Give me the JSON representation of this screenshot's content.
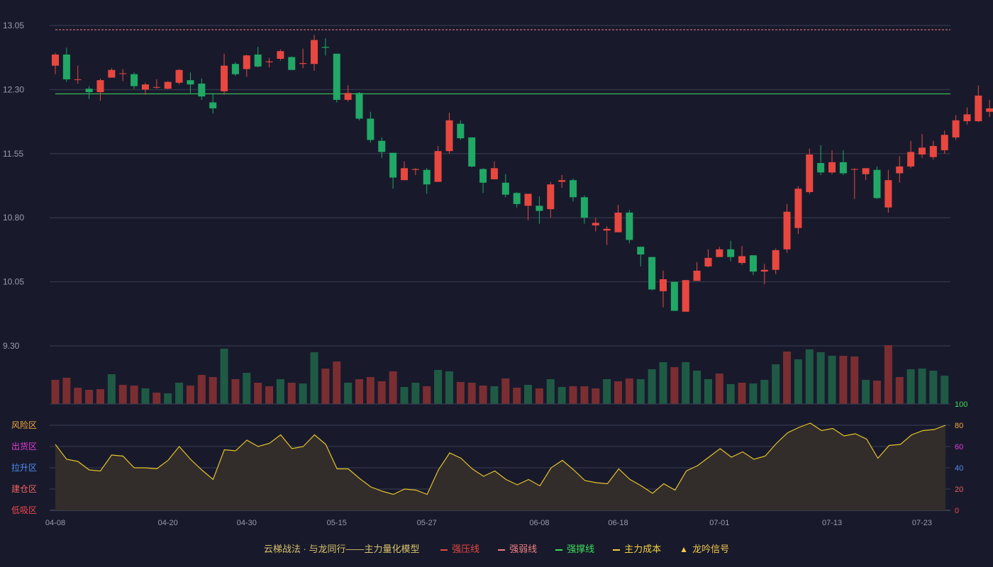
{
  "colors": {
    "background": "#181a2c",
    "up": "#e8473f",
    "down": "#21a866",
    "vol_up": "#7a2e31",
    "vol_down": "#1f5a45",
    "grid": "#3a3d52",
    "tick": "#9a9cab",
    "resistance": "#e8473f",
    "weak": "#f07f80",
    "support": "#3ddc5a",
    "cost": "#f2d13e",
    "osc_line": "#e5c22b",
    "osc_fill": "#322d2a",
    "zone_risk": "#f1a73a",
    "zone_ship": "#e13cd6",
    "zone_rise": "#4f8ef0",
    "zone_build": "#ef6060",
    "zone_low": "#f0464a"
  },
  "footer": {
    "title": "云梯战法 · 与龙同行——主力量化模型",
    "items": [
      {
        "label": "强压线",
        "color": "#e8473f",
        "style": "solid"
      },
      {
        "label": "强弱线",
        "color": "#f07f80",
        "style": "dash"
      },
      {
        "label": "强撑线",
        "color": "#3ddc5a",
        "style": "solid"
      },
      {
        "label": "主力成本",
        "color": "#f2d13e",
        "style": "dash"
      },
      {
        "label": "龙吟信号",
        "color": "#f2c84b",
        "style": "triangle",
        "symbol": "▲"
      }
    ]
  },
  "chart_data": [
    {
      "type": "candlestick",
      "title": "",
      "x": [
        "04-08",
        "04-09",
        "04-10",
        "04-11",
        "04-12",
        "04-15",
        "04-16",
        "04-17",
        "04-18",
        "04-19",
        "04-20",
        "04-22",
        "04-23",
        "04-24",
        "04-25",
        "04-26",
        "04-29",
        "04-30",
        "05-06",
        "05-07",
        "05-08",
        "05-09",
        "05-10",
        "05-13",
        "05-14",
        "05-15",
        "05-16",
        "05-17",
        "05-20",
        "05-21",
        "05-22",
        "05-23",
        "05-24",
        "05-27",
        "05-28",
        "05-29",
        "05-30",
        "05-31",
        "06-03",
        "06-04",
        "06-05",
        "06-06",
        "06-07",
        "06-08",
        "06-11",
        "06-12",
        "06-13",
        "06-14",
        "06-15",
        "06-17",
        "06-18",
        "06-19",
        "06-20",
        "06-21",
        "06-24",
        "06-25",
        "06-26",
        "06-27",
        "06-28",
        "07-01",
        "07-02",
        "07-03",
        "07-04",
        "07-05",
        "07-08",
        "07-09",
        "07-10",
        "07-11",
        "07-12",
        "07-13",
        "07-15",
        "07-16",
        "07-17",
        "07-18",
        "07-19",
        "07-20",
        "07-22",
        "07-23",
        "07-24",
        "07-25",
        "07-26",
        "07-29",
        "07-30",
        "07-31",
        "08-01",
        "08-02",
        "08-05"
      ],
      "x_ticks": [
        "04-08",
        "04-20",
        "04-30",
        "05-15",
        "05-27",
        "06-08",
        "06-18",
        "07-01",
        "07-13",
        "07-23"
      ],
      "y_ticks": [
        "9.30",
        "10.05",
        "10.80",
        "11.55",
        "12.30",
        "13.05"
      ],
      "ylim": [
        9.3,
        13.05
      ],
      "ohlc": [
        [
          12.58,
          12.71,
          12.48,
          12.73
        ],
        [
          12.71,
          12.42,
          12.39,
          12.79
        ],
        [
          12.42,
          12.42,
          12.37,
          12.58
        ],
        [
          12.31,
          12.27,
          12.19,
          12.34
        ],
        [
          12.27,
          12.41,
          12.17,
          12.43
        ],
        [
          12.44,
          12.53,
          12.44,
          12.55
        ],
        [
          12.49,
          12.49,
          12.4,
          12.54
        ],
        [
          12.48,
          12.34,
          12.31,
          12.5
        ],
        [
          12.3,
          12.36,
          12.24,
          12.38
        ],
        [
          12.33,
          12.33,
          12.31,
          12.42
        ],
        [
          12.31,
          12.39,
          12.3,
          12.4
        ],
        [
          12.38,
          12.53,
          12.36,
          12.54
        ],
        [
          12.41,
          12.36,
          12.25,
          12.5
        ],
        [
          12.37,
          12.22,
          12.18,
          12.43
        ],
        [
          12.15,
          12.08,
          12.02,
          12.26
        ],
        [
          12.28,
          12.58,
          12.24,
          12.72
        ],
        [
          12.6,
          12.48,
          12.46,
          12.62
        ],
        [
          12.54,
          12.7,
          12.45,
          12.71
        ],
        [
          12.71,
          12.57,
          12.56,
          12.8
        ],
        [
          12.62,
          12.63,
          12.56,
          12.67
        ],
        [
          12.66,
          12.75,
          12.64,
          12.77
        ],
        [
          12.68,
          12.53,
          12.53,
          12.69
        ],
        [
          12.6,
          12.61,
          12.55,
          12.78
        ],
        [
          12.6,
          12.88,
          12.52,
          12.94
        ],
        [
          12.8,
          12.79,
          12.7,
          12.9
        ],
        [
          12.72,
          12.18,
          12.15,
          12.72
        ],
        [
          12.18,
          12.26,
          12.16,
          12.35
        ],
        [
          12.26,
          11.96,
          11.94,
          12.27
        ],
        [
          11.96,
          11.71,
          11.68,
          12.04
        ],
        [
          11.7,
          11.57,
          11.5,
          11.74
        ],
        [
          11.56,
          11.27,
          11.14,
          11.56
        ],
        [
          11.24,
          11.38,
          11.24,
          11.46
        ],
        [
          11.36,
          11.37,
          11.3,
          11.38
        ],
        [
          11.36,
          11.19,
          11.08,
          11.38
        ],
        [
          11.22,
          11.58,
          11.22,
          11.64
        ],
        [
          11.58,
          11.94,
          11.55,
          12.03
        ],
        [
          11.9,
          11.73,
          11.71,
          11.94
        ],
        [
          11.74,
          11.4,
          11.39,
          11.74
        ],
        [
          11.37,
          11.21,
          11.09,
          11.38
        ],
        [
          11.25,
          11.38,
          11.25,
          11.46
        ],
        [
          11.21,
          11.07,
          11.04,
          11.31
        ],
        [
          11.09,
          10.96,
          10.92,
          11.1
        ],
        [
          10.94,
          11.08,
          10.77,
          11.08
        ],
        [
          10.94,
          10.88,
          10.73,
          11.05
        ],
        [
          10.9,
          11.19,
          10.8,
          11.22
        ],
        [
          11.22,
          11.24,
          11.15,
          11.3
        ],
        [
          11.24,
          11.04,
          10.99,
          11.26
        ],
        [
          11.04,
          10.8,
          10.73,
          11.06
        ],
        [
          10.71,
          10.74,
          10.64,
          10.8
        ],
        [
          10.65,
          10.67,
          10.48,
          10.7
        ],
        [
          10.63,
          10.86,
          10.63,
          10.95
        ],
        [
          10.86,
          10.54,
          10.5,
          10.89
        ],
        [
          10.46,
          10.37,
          10.23,
          10.46
        ],
        [
          10.34,
          9.96,
          9.95,
          10.34
        ],
        [
          9.94,
          10.08,
          9.75,
          10.18
        ],
        [
          10.05,
          9.71,
          9.82,
          10.05
        ],
        [
          9.7,
          10.07,
          9.8,
          10.07
        ],
        [
          10.06,
          10.18,
          10.08,
          10.28
        ],
        [
          10.23,
          10.33,
          10.22,
          10.43
        ],
        [
          10.34,
          10.43,
          10.34,
          10.46
        ],
        [
          10.43,
          10.34,
          10.29,
          10.53
        ],
        [
          10.27,
          10.35,
          10.25,
          10.47
        ],
        [
          10.36,
          10.17,
          10.13,
          10.36
        ],
        [
          10.17,
          10.19,
          10.02,
          10.26
        ],
        [
          10.19,
          10.42,
          10.14,
          10.44
        ],
        [
          10.43,
          10.87,
          10.39,
          10.96
        ],
        [
          10.68,
          11.14,
          10.61,
          11.17
        ],
        [
          11.1,
          11.54,
          11.08,
          11.61
        ],
        [
          11.44,
          11.33,
          11.3,
          11.65
        ],
        [
          11.33,
          11.45,
          11.31,
          11.59
        ],
        [
          11.45,
          11.32,
          11.3,
          11.59
        ],
        [
          11.37,
          11.37,
          11.02,
          11.38
        ],
        [
          11.31,
          11.38,
          11.24,
          11.38
        ],
        [
          11.36,
          11.03,
          11.02,
          11.4
        ],
        [
          10.92,
          11.24,
          10.86,
          11.36
        ],
        [
          11.32,
          11.4,
          11.21,
          11.52
        ],
        [
          11.4,
          11.57,
          11.38,
          11.7
        ],
        [
          11.54,
          11.62,
          11.5,
          11.78
        ],
        [
          11.51,
          11.64,
          11.48,
          11.7
        ],
        [
          11.59,
          11.77,
          11.55,
          11.82
        ],
        [
          11.74,
          11.94,
          11.71,
          12.0
        ],
        [
          11.93,
          12.01,
          11.89,
          12.09
        ],
        [
          11.93,
          12.23,
          11.92,
          12.35
        ],
        [
          12.04,
          12.08,
          11.98,
          12.18
        ],
        [
          12.13,
          12.05,
          12.01,
          12.18
        ],
        [
          12.14,
          12.16,
          12.04,
          12.19
        ],
        [
          12.16,
          12.29,
          12.11,
          12.34
        ]
      ],
      "reference_lines": [
        {
          "name": "强弱线",
          "value": 13.0,
          "style": "dash"
        },
        {
          "name": "强撑线",
          "value": 12.25,
          "style": "solid"
        }
      ]
    },
    {
      "type": "bar",
      "title": "",
      "values": [
        34,
        37,
        23,
        20,
        21,
        42,
        27,
        26,
        22,
        16,
        15,
        30,
        26,
        41,
        38,
        78,
        35,
        44,
        30,
        25,
        35,
        30,
        29,
        73,
        50,
        60,
        30,
        35,
        38,
        32,
        46,
        24,
        30,
        25,
        48,
        46,
        31,
        30,
        26,
        25,
        36,
        23,
        27,
        22,
        35,
        24,
        25,
        25,
        22,
        35,
        32,
        36,
        35,
        49,
        59,
        52,
        59,
        47,
        35,
        43,
        28,
        30,
        29,
        34,
        56,
        74,
        63,
        77,
        73,
        68,
        68,
        67,
        34,
        33,
        83,
        38,
        49,
        50,
        47,
        40
      ],
      "direction": [
        "up",
        "up",
        "up",
        "up",
        "up",
        "down",
        "up",
        "up",
        "down",
        "up",
        "down",
        "down",
        "up",
        "up",
        "up",
        "down",
        "up",
        "down",
        "up",
        "up",
        "down",
        "up",
        "down",
        "down",
        "up",
        "up",
        "down",
        "up",
        "up",
        "up",
        "up",
        "down",
        "down",
        "up",
        "down",
        "down",
        "up",
        "up",
        "up",
        "down",
        "up",
        "up",
        "down",
        "up",
        "down",
        "down",
        "up",
        "up",
        "up",
        "down",
        "up",
        "up",
        "down",
        "down",
        "down",
        "up",
        "down",
        "down",
        "down",
        "up",
        "down",
        "up",
        "down",
        "down",
        "down",
        "up",
        "down",
        "down",
        "down",
        "down",
        "up",
        "up",
        "down",
        "up",
        "up",
        "up",
        "down",
        "down",
        "down",
        "down"
      ],
      "ylim": [
        0,
        80
      ]
    },
    {
      "type": "area",
      "title": "",
      "y_ticks": [
        "0",
        "20",
        "40",
        "60",
        "80",
        "100"
      ],
      "ylim": [
        0,
        100
      ],
      "zones": [
        "风险区",
        "出货区",
        "拉升区",
        "建仓区",
        "低吸区"
      ],
      "values": [
        62,
        48,
        46,
        38,
        37,
        52,
        51,
        40,
        40,
        39,
        47,
        60,
        48,
        38,
        29,
        57,
        56,
        66,
        60,
        63,
        71,
        58,
        60,
        71,
        62,
        39,
        39,
        30,
        22,
        18,
        15,
        20,
        19,
        15,
        38,
        54,
        49,
        39,
        32,
        37,
        29,
        24,
        29,
        23,
        40,
        47,
        38,
        28,
        26,
        25,
        39,
        29,
        23,
        16,
        25,
        19,
        37,
        42,
        50,
        58,
        50,
        55,
        48,
        51,
        63,
        73,
        78,
        82,
        75,
        77,
        70,
        72,
        67,
        49,
        61,
        62,
        71,
        75,
        76,
        80
      ]
    }
  ]
}
